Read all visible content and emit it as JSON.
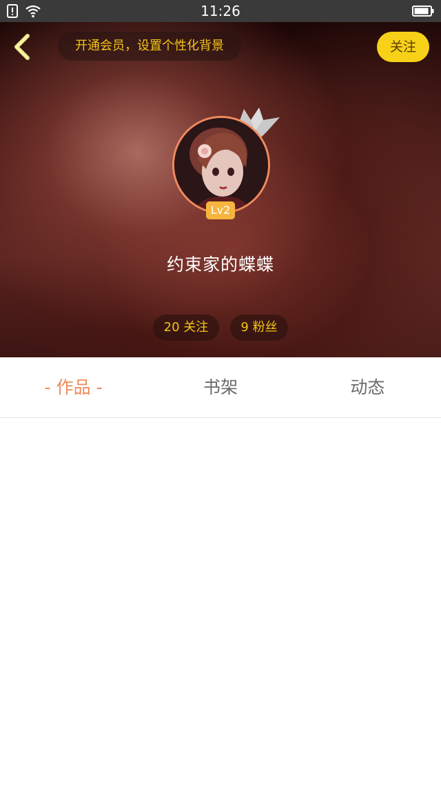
{
  "status_bar": {
    "time": "11:26",
    "icons": [
      "sim-alert-icon",
      "wifi-icon",
      "battery-icon"
    ]
  },
  "header": {
    "vip_banner": "开通会员，设置个性化背景",
    "follow_label": "关注",
    "level": "Lv2",
    "username": "约束家的蝶蝶",
    "stats": {
      "following": "20 关注",
      "fans": "9 粉丝"
    }
  },
  "tabs": [
    {
      "label": "作品",
      "active": true,
      "prefix": "-",
      "suffix": "-"
    },
    {
      "label": "书架",
      "active": false
    },
    {
      "label": "动态",
      "active": false
    }
  ],
  "colors": {
    "accent_yellow": "#f7d117",
    "banner_text": "#f5c518",
    "active_tab": "#ee8a5a",
    "inactive_tab": "#6a6a6a",
    "level_badge": "#f6b53f",
    "avatar_border": "#f08a5d"
  }
}
